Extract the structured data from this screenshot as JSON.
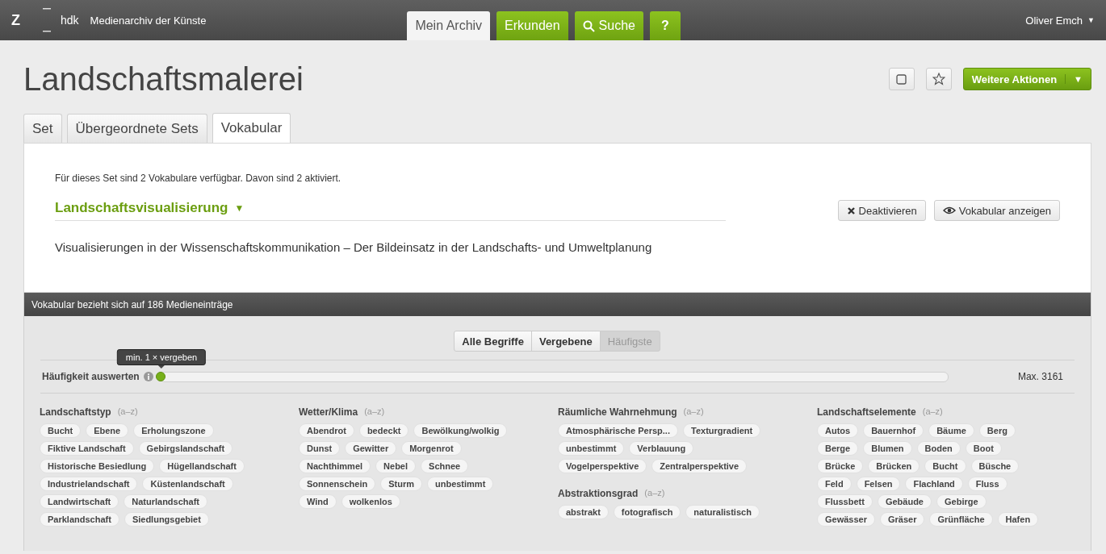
{
  "topbar": {
    "logo": "Z",
    "brand": "hdk",
    "subtitle": "Medienarchiv der Künste",
    "nav": [
      {
        "label": "Mein Archiv",
        "kind": "plain",
        "selected": true
      },
      {
        "label": "Erkunden",
        "kind": "plain",
        "selected": false
      },
      {
        "label": "Suche",
        "kind": "search",
        "selected": false
      },
      {
        "label": "?",
        "kind": "help",
        "selected": false
      }
    ],
    "user": "Oliver Emch",
    "user_caret": "▼"
  },
  "header": {
    "title": "Landschaftsmalerei",
    "actions_label": "Weitere Aktionen",
    "actions_caret": "▼"
  },
  "tabs": [
    {
      "label": "Set",
      "selected": false
    },
    {
      "label": "Übergeordnete Sets",
      "selected": false
    },
    {
      "label": "Vokabular",
      "selected": true
    }
  ],
  "vocabulary": {
    "summary": "Für dieses Set sind 2 Vokabulare verfügbar. Davon sind 2 aktiviert.",
    "name": "Landschaftsvisualisierung",
    "name_caret": "▼",
    "expanded": true,
    "buttons": [
      {
        "label": "Deaktivieren",
        "kind": "deactivate"
      },
      {
        "label": "Vokabular anzeigen",
        "kind": "view"
      }
    ],
    "description": "Visualisierungen in der Wissenschaftskommunikation – Der Bildeinsatz in der Landschafts- und Umweltplanung"
  },
  "terms": {
    "header": "Vokabular bezieht sich auf 186 Medieneinträge",
    "filters": [
      {
        "label": "Alle Begriffe",
        "selected": false
      },
      {
        "label": "Vergebene",
        "selected": false
      },
      {
        "label": "Häufigste",
        "selected": true
      }
    ],
    "frequency": {
      "label": "Häufigkeit auswerten",
      "tooltip": "min. 1 × vergeben",
      "level": 0,
      "max": "Max. 3161"
    },
    "columns": [
      {
        "groups": [
          {
            "title": "Landschaftstyp",
            "sort": "(a–z)",
            "tag_rows": [
              [
                "Bucht",
                "Ebene",
                "Erholungszone"
              ],
              [
                "Fiktive Landschaft",
                "Gebirgslandschaft"
              ],
              [
                "Historische Besiedlung",
                "Hügellandschaft"
              ],
              [
                "Industrielandschaft",
                "Küstenlandschaft"
              ],
              [
                "Landwirtschaft",
                "Naturlandschaft"
              ],
              [
                "Parklandschaft",
                "Siedlungsgebiet"
              ]
            ]
          }
        ]
      },
      {
        "groups": [
          {
            "title": "Wetter/Klima",
            "sort": "(a–z)",
            "tag_rows": [
              [
                "Abendrot",
                "bedeckt",
                "Bewölkung/wolkig"
              ],
              [
                "Dunst",
                "Gewitter",
                "Morgenrot"
              ],
              [
                "Nachthimmel",
                "Nebel",
                "Schnee"
              ],
              [
                "Sonnenschein",
                "Sturm",
                "unbestimmt"
              ],
              [
                "Wind",
                "wolkenlos"
              ]
            ]
          }
        ]
      },
      {
        "groups": [
          {
            "title": "Räumliche Wahrnehmung",
            "sort": "(a–z)",
            "tag_rows": [
              [
                "Atmosphärische Persp...",
                "Texturgradient"
              ],
              [
                "unbestimmt",
                "Verblauung"
              ],
              [
                "Vogelperspektive",
                "Zentralperspektive"
              ]
            ]
          },
          {
            "title": "Abstraktionsgrad",
            "sort": "(a–z)",
            "tag_rows": [
              [
                "abstrakt",
                "fotografisch",
                "naturalistisch"
              ]
            ]
          }
        ]
      },
      {
        "groups": [
          {
            "title": "Landschaftselemente",
            "sort": "(a–z)",
            "tag_rows": [
              [
                "Autos",
                "Bauernhof",
                "Bäume",
                "Berg"
              ],
              [
                "Berge",
                "Blumen",
                "Boden",
                "Boot"
              ],
              [
                "Brücke",
                "Brücken",
                "Bucht",
                "Büsche"
              ],
              [
                "Feld",
                "Felsen",
                "Flachland",
                "Fluss"
              ],
              [
                "Flussbett",
                "Gebäude",
                "Gebirge"
              ],
              [
                "Gewässer",
                "Gräser",
                "Grünfläche",
                "Hafen"
              ]
            ]
          }
        ]
      }
    ]
  }
}
